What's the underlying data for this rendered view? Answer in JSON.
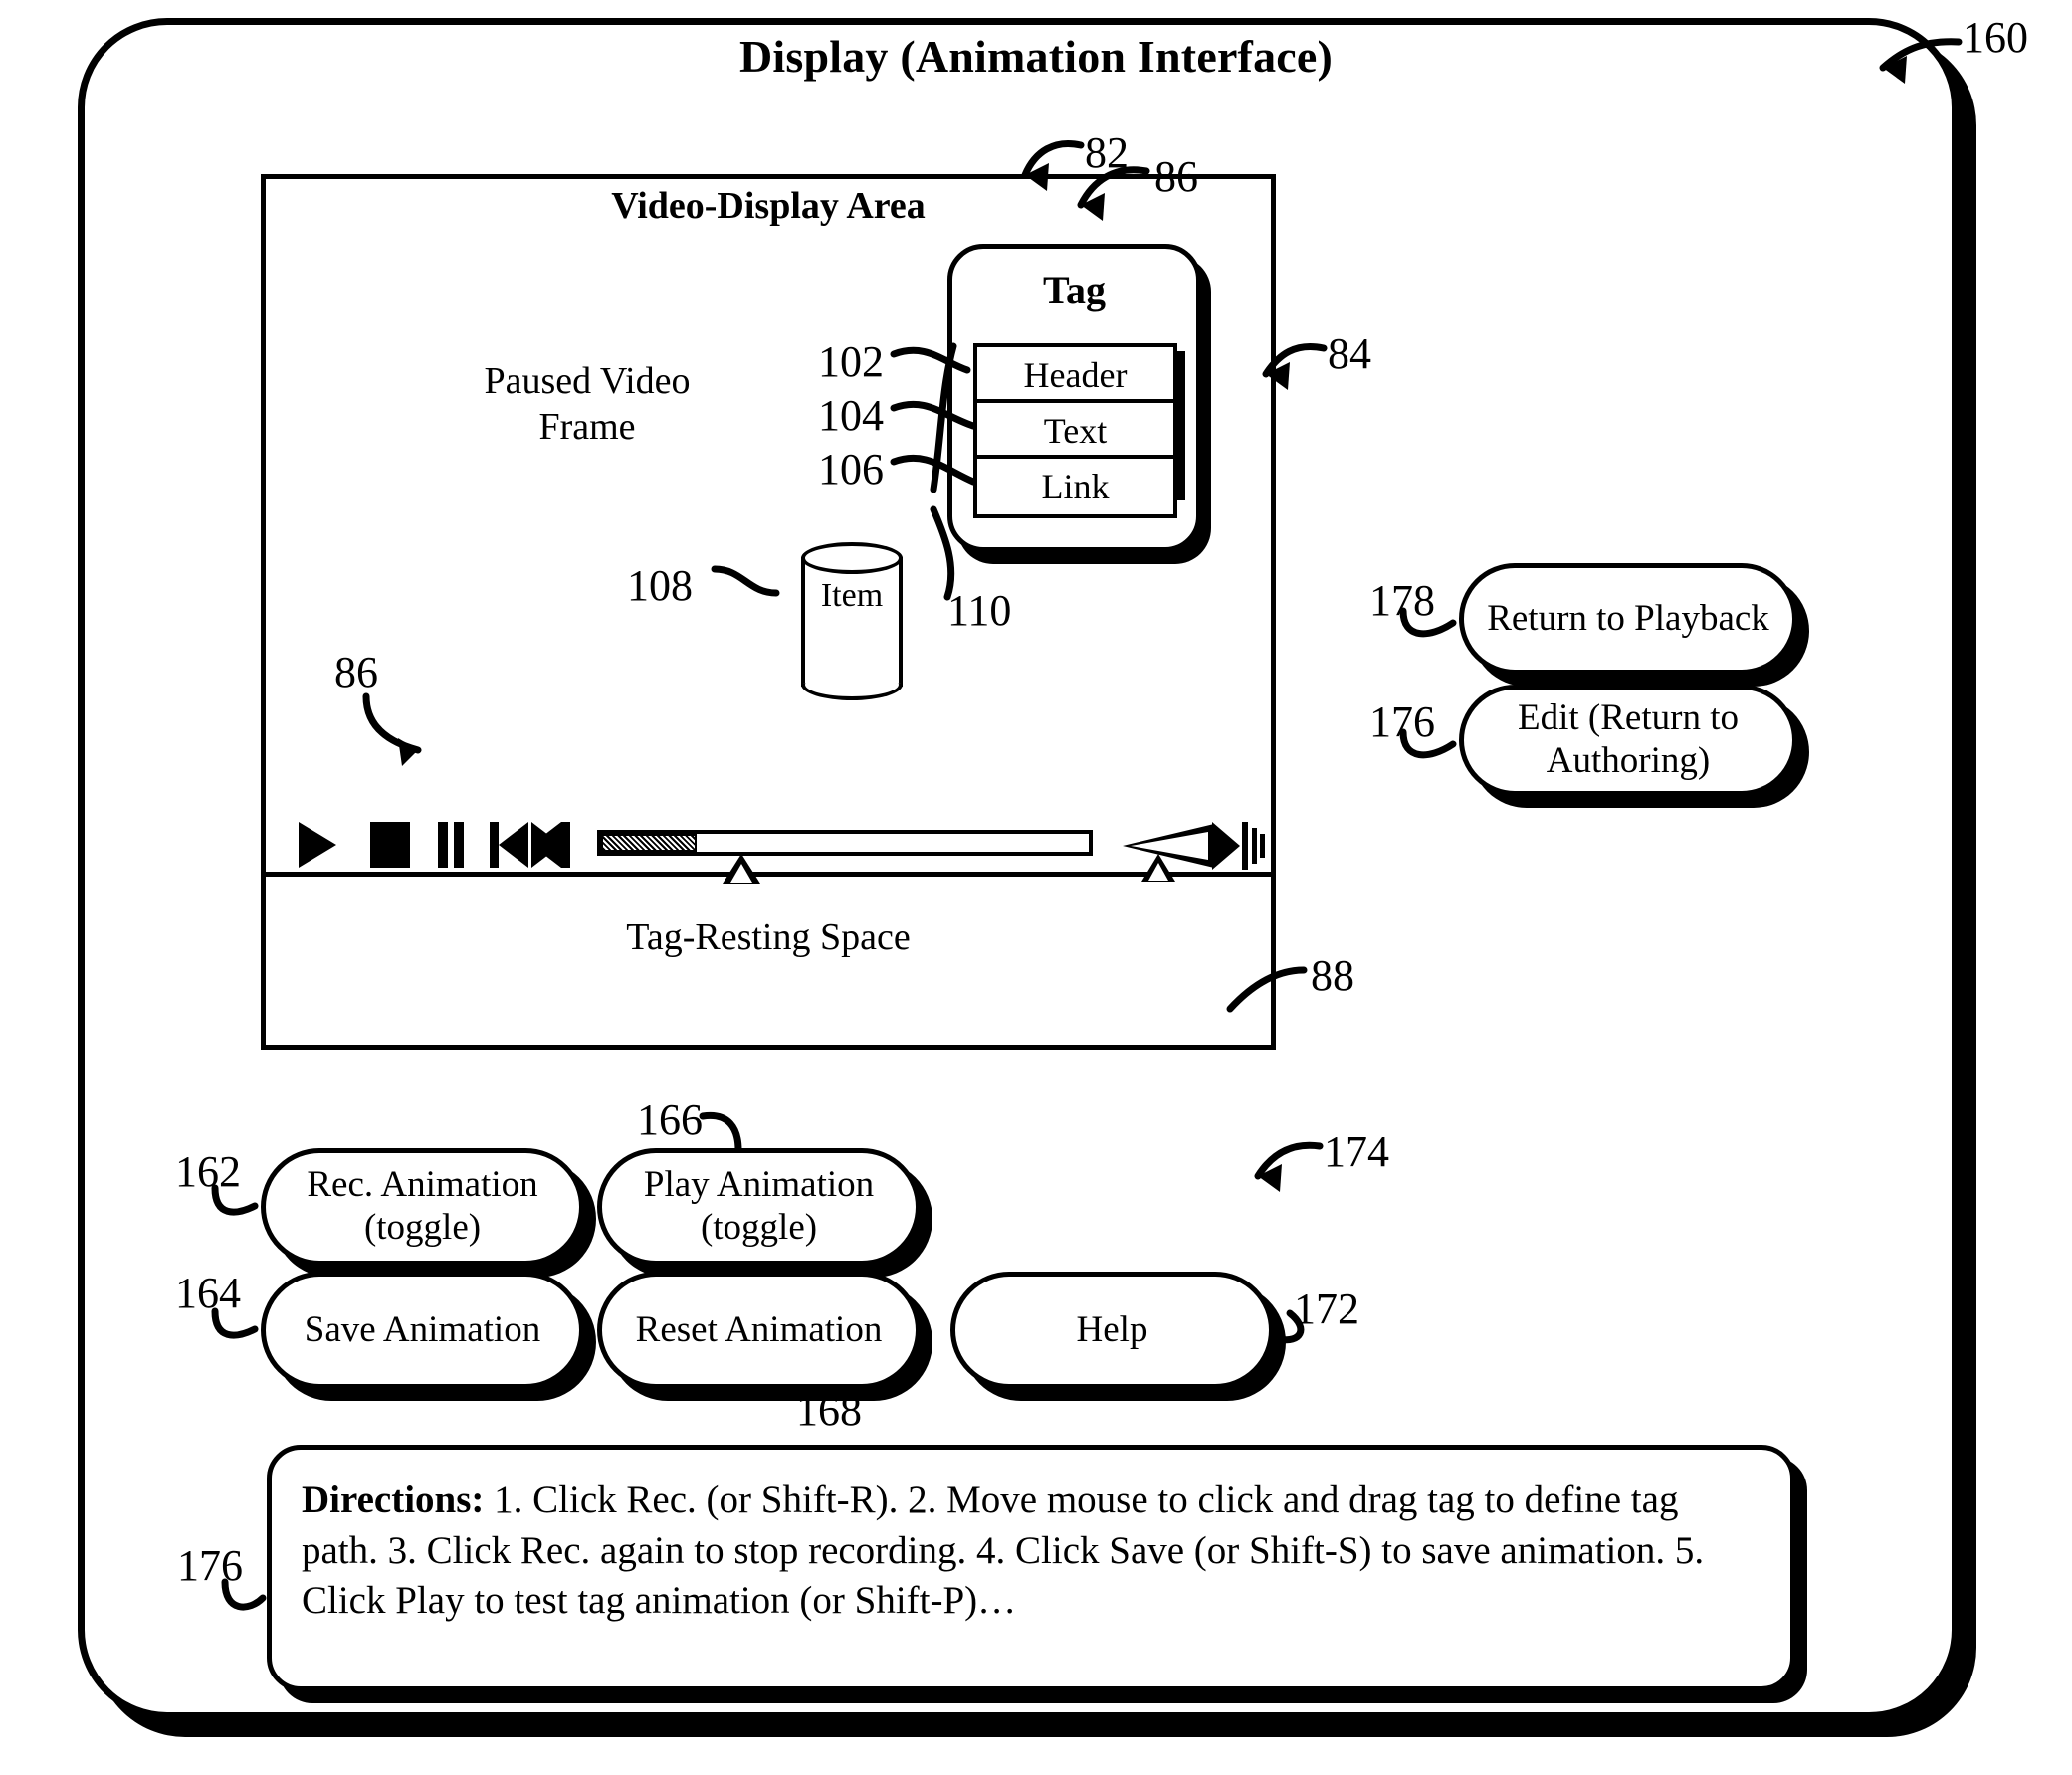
{
  "figure": {
    "title": "Display (Animation Interface)",
    "ref_main": "160"
  },
  "video_area": {
    "title": "Video-Display Area",
    "ref": "82",
    "border_ref": "84",
    "paused_frame_label": "Paused Video Frame",
    "tag_resting_space_label": "Tag-Resting Space",
    "tag_resting_ref": "88",
    "controls_ref": "86"
  },
  "tag": {
    "title": "Tag",
    "ref": "86",
    "rows": [
      {
        "label": "Header",
        "ref": "102"
      },
      {
        "label": "Text",
        "ref": "104"
      },
      {
        "label": "Link",
        "ref": "106"
      }
    ],
    "anchor_ref": "110"
  },
  "item": {
    "label": "Item",
    "ref": "108"
  },
  "player_controls": {
    "icons": [
      "play-icon",
      "stop-icon",
      "pause-icon",
      "previous-track-icon",
      "next-track-icon",
      "seek-slider",
      "volume-slider",
      "speaker-icon"
    ]
  },
  "side_buttons": [
    {
      "label": "Return to Playback",
      "ref": "178",
      "name": "return-to-playback-button"
    },
    {
      "label": "Edit (Return to Authoring)",
      "ref": "176",
      "name": "edit-return-to-authoring-button"
    }
  ],
  "bottom_buttons": [
    {
      "label": "Rec. Animation (toggle)",
      "ref": "162",
      "name": "record-animation-button"
    },
    {
      "label": "Play Animation (toggle)",
      "ref": "166",
      "name": "play-animation-button"
    },
    {
      "label": "Save Animation",
      "ref": "164",
      "name": "save-animation-button"
    },
    {
      "label": "Reset Animation",
      "ref": "168",
      "name": "reset-animation-button"
    },
    {
      "label": "Help",
      "ref": "172",
      "name": "help-button"
    }
  ],
  "button_group_ref": "174",
  "directions": {
    "ref": "176",
    "heading": "Directions:",
    "body": " 1. Click Rec. (or Shift-R). 2. Move mouse to click and drag tag to define tag path. 3. Click Rec. again to stop recording. 4. Click Save (or Shift-S) to save animation. 5. Click Play to test tag animation (or Shift-P)…"
  },
  "colors": {
    "ink": "#000000",
    "paper": "#ffffff"
  }
}
